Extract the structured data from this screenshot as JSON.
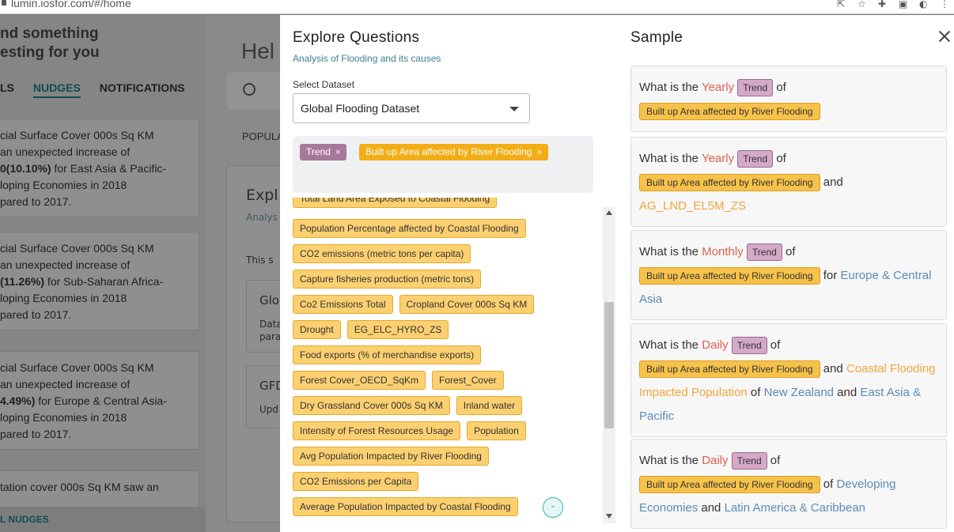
{
  "browser": {
    "url": "lumin.iosfor.com/#/home"
  },
  "background": {
    "heading_line1": "nd something",
    "heading_line2": "esting for you",
    "tabs": [
      "LS",
      "NUDGES",
      "NOTIFICATIONS"
    ],
    "main_title": "Hel",
    "popul": "POPULA",
    "footer": "L NUDGES",
    "panel_title": "Expl",
    "panel_sub": "Analys",
    "panel_text": "This s",
    "card1_title": "Glo",
    "card1_line1": "Data",
    "card1_line2": "para",
    "card2_title": "GFD",
    "card2_line": "Upd",
    "nudges": [
      {
        "l1": "cial Surface Cover 000s Sq KM",
        "l2": "an unexpected increase of",
        "l3a": "0(10.10%)",
        "l3b": " for East Asia & Pacific-",
        "l4": "loping Economies in 2018",
        "l5": "pared to 2017."
      },
      {
        "l1": "cial Surface Cover 000s Sq KM",
        "l2": "an unexpected increase of",
        "l3a": "(11.26%)",
        "l3b": " for Sub-Saharan Africa-",
        "l4": "loping Economies in 2018",
        "l5": "pared to 2017."
      },
      {
        "l1": "cial Surface Cover 000s Sq KM",
        "l2": "an unexpected increase of",
        "l3a": "4.49%)",
        "l3b": " for Europe & Central Asia-",
        "l4": "loping Economies in 2018",
        "l5": "pared to 2017."
      },
      {
        "l1": "tation cover 000s Sq KM saw an"
      }
    ]
  },
  "explore": {
    "title": "Explore Questions",
    "subtitle": "Analysis of Flooding and its causes",
    "dataset_label": "Select Dataset",
    "dataset_value": "Global Flooding Dataset",
    "selected": [
      {
        "label": "Trend",
        "remove": "×"
      },
      {
        "label": "Built up Area affected by River Flooding",
        "remove": "×"
      }
    ],
    "partial_option": "Total Land Area Exposed to Coastal Flooding",
    "option_rows": [
      [
        "Population Percentage affected by Coastal Flooding"
      ],
      [
        "CO2 emissions (metric tons per capita)"
      ],
      [
        "Capture fisheries production (metric tons)"
      ],
      [
        "Co2 Emissions Total",
        "Cropland Cover 000s Sq KM"
      ],
      [
        "Drought",
        "EG_ELC_HYRO_ZS"
      ],
      [
        "Food exports (% of merchandise exports)"
      ],
      [
        "Forest Cover_OECD_SqKm",
        "Forest_Cover"
      ],
      [
        "Dry Grassland Cover 000s Sq KM",
        "Inland water"
      ],
      [
        "Intensity of Forest Resources Usage",
        "Population"
      ],
      [
        "Avg Population Impacted by River Flooding"
      ],
      [
        "CO2 Emissions per Capita"
      ],
      [
        "Average Population Impacted by Coastal Flooding"
      ]
    ],
    "collapse_label": "-"
  },
  "sample": {
    "title": "Sample",
    "q1": {
      "a": "What is the ",
      "kw": "Yearly",
      "tag": "Trend",
      "b": " of",
      "metric": "Built up Area affected by River Flooding"
    },
    "q2": {
      "a": "What is the ",
      "kw": "Yearly",
      "tag": "Trend",
      "b": " of",
      "metric": "Built up Area affected by River Flooding",
      "c": " and",
      "ag": "AG_LND_EL5M_ZS"
    },
    "q3": {
      "a": "What is the ",
      "kw": "Monthly",
      "tag": "Trend",
      "b": " of",
      "metric": "Built up Area affected by River Flooding",
      "c": " for ",
      "link": "Europe & Central Asia"
    },
    "q4": {
      "a": "What is the ",
      "kw": "Daily",
      "tag": "Trend",
      "b": " of",
      "metric": "Built up Area affected by River Flooding",
      "c": " and ",
      "ag": "Coastal Flooding Impacted Population",
      "d": " of ",
      "link1": "New Zealand",
      "e": " and ",
      "link2": "East Asia & Pacific"
    },
    "q5": {
      "a": "What is the ",
      "kw": "Daily",
      "tag": "Trend",
      "b": " of",
      "metric": "Built up Area affected by River Flooding",
      "c": " of ",
      "link1": "Developing Economies",
      "d": " and ",
      "link2": "Latin America & Caribbean"
    }
  }
}
